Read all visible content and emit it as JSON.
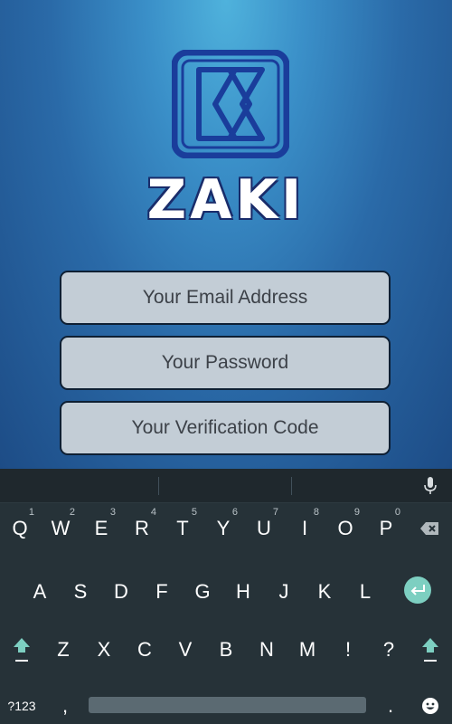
{
  "app": {
    "brand_name": "ZAKI"
  },
  "form": {
    "email_placeholder": "Your Email Address",
    "password_placeholder": "Your Password",
    "verification_placeholder": "Your Verification Code"
  },
  "keyboard": {
    "row1": [
      {
        "key": "Q",
        "hint": "1"
      },
      {
        "key": "W",
        "hint": "2"
      },
      {
        "key": "E",
        "hint": "3"
      },
      {
        "key": "R",
        "hint": "4"
      },
      {
        "key": "T",
        "hint": "5"
      },
      {
        "key": "Y",
        "hint": "6"
      },
      {
        "key": "U",
        "hint": "7"
      },
      {
        "key": "I",
        "hint": "8"
      },
      {
        "key": "O",
        "hint": "9"
      },
      {
        "key": "P",
        "hint": "0"
      }
    ],
    "row2": [
      "A",
      "S",
      "D",
      "F",
      "G",
      "H",
      "J",
      "K",
      "L"
    ],
    "row3": [
      "Z",
      "X",
      "C",
      "V",
      "B",
      "N",
      "M",
      "!",
      "?"
    ],
    "symbols_label": "?123",
    "comma_label": ",",
    "period_label": "."
  },
  "colors": {
    "accent": "#7dcfc1",
    "keyboard_bg": "#263238",
    "field_bg": "#c3cdd6",
    "logo_blue": "#1a3d9b"
  },
  "icons": [
    "mic-icon",
    "backspace-icon",
    "enter-icon",
    "shift-icon",
    "emoji-icon"
  ]
}
